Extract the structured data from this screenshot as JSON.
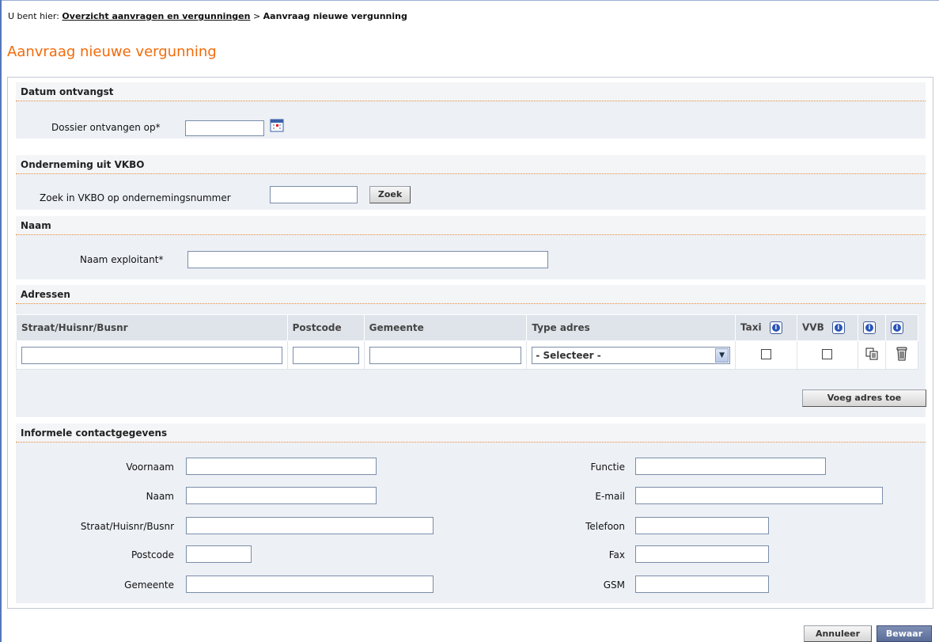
{
  "breadcrumb": {
    "prefix": "U bent hier:",
    "link": "Overzicht aanvragen en vergunningen",
    "separator": ">",
    "current": "Aanvraag nieuwe vergunning"
  },
  "page_title": "Aanvraag nieuwe vergunning",
  "sections": {
    "datum": {
      "title": "Datum ontvangst",
      "dossier_label": "Dossier ontvangen op*",
      "dossier_value": ""
    },
    "onderneming": {
      "title": "Onderneming uit VKBO",
      "search_label": "Zoek in VKBO op ondernemingsnummer",
      "search_value": "",
      "search_button": "Zoek"
    },
    "naam": {
      "title": "Naam",
      "exploitant_label": "Naam exploitant*",
      "exploitant_value": ""
    },
    "adressen": {
      "title": "Adressen",
      "columns": {
        "straat": "Straat/Huisnr/Busnr",
        "postcode": "Postcode",
        "gemeente": "Gemeente",
        "type": "Type adres",
        "taxi": "Taxi",
        "vvb": "VVB"
      },
      "row": {
        "straat": "",
        "postcode": "",
        "gemeente": "",
        "type_selected": "- Selecteer -",
        "taxi_checked": false,
        "vvb_checked": false
      },
      "add_button": "Voeg adres toe"
    },
    "contact": {
      "title": "Informele contactgegevens",
      "left": {
        "voornaam": "Voornaam",
        "naam": "Naam",
        "straat": "Straat/Huisnr/Busnr",
        "postcode": "Postcode",
        "gemeente": "Gemeente"
      },
      "right": {
        "functie": "Functie",
        "email": "E-mail",
        "telefoon": "Telefoon",
        "fax": "Fax",
        "gsm": "GSM"
      }
    }
  },
  "footer": {
    "cancel": "Annuleer",
    "save": "Bewaar"
  },
  "colors": {
    "title": "#f26b0a",
    "section_bg": "#edf0f5",
    "border_accent": "#e38a3a"
  }
}
